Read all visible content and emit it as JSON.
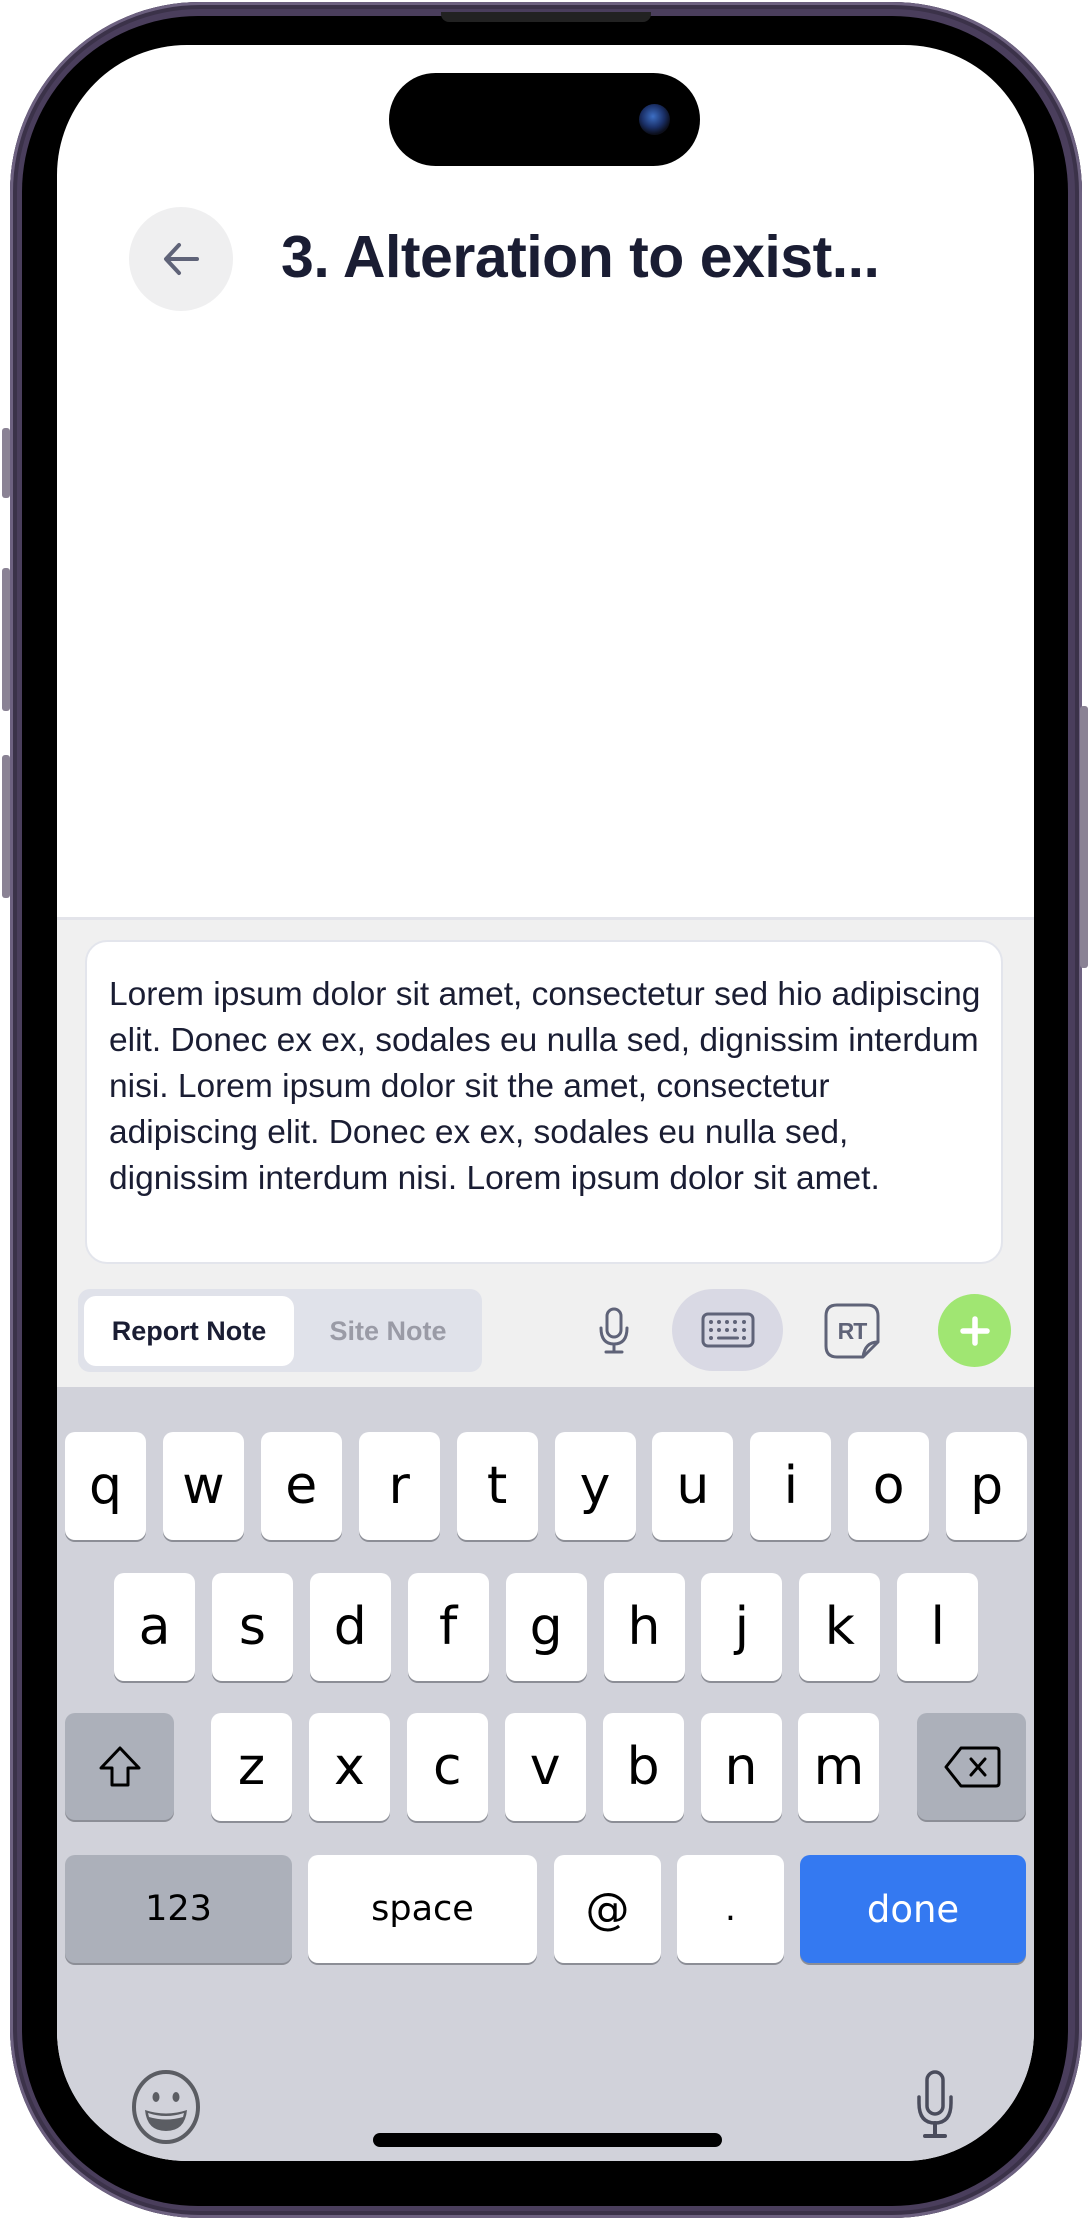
{
  "header": {
    "back_icon": "arrow-left-icon",
    "title": "3. Alteration to exist..."
  },
  "composer": {
    "note_text": "Lorem ipsum dolor sit amet, consectetur sed hio adipiscing elit. Donec ex ex, sodales eu nulla sed, dignissim interdum nisi. Lorem ipsum dolor sit the amet, consectetur adipiscing elit. Donec ex ex, sodales eu nulla sed, dignissim interdum nisi. Lorem ipsum dolor sit amet.",
    "tabs": [
      {
        "label": "Report Note",
        "active": true
      },
      {
        "label": "Site Note",
        "active": false
      }
    ],
    "tools": {
      "mic_icon": "microphone-icon",
      "keyboard_icon": "keyboard-icon",
      "rt_label": "RT",
      "add_icon": "plus-icon"
    },
    "colors": {
      "add_button": "#a0e672",
      "keyboard_toggle_bg": "#d9d9e4",
      "title_text": "#1a1d33"
    }
  },
  "keyboard": {
    "row1": [
      "q",
      "w",
      "e",
      "r",
      "t",
      "y",
      "u",
      "i",
      "o",
      "p"
    ],
    "row2": [
      "a",
      "s",
      "d",
      "f",
      "g",
      "h",
      "j",
      "k",
      "l"
    ],
    "row3": [
      "z",
      "x",
      "c",
      "v",
      "b",
      "n",
      "m"
    ],
    "shift_icon": "shift-icon",
    "delete_icon": "backspace-icon",
    "numbers_label": "123",
    "space_label": "space",
    "at_label": "@",
    "period_label": ".",
    "done_label": "done",
    "emoji_icon": "emoji-icon",
    "dictation_icon": "microphone-icon",
    "done_color": "#3479f1"
  }
}
